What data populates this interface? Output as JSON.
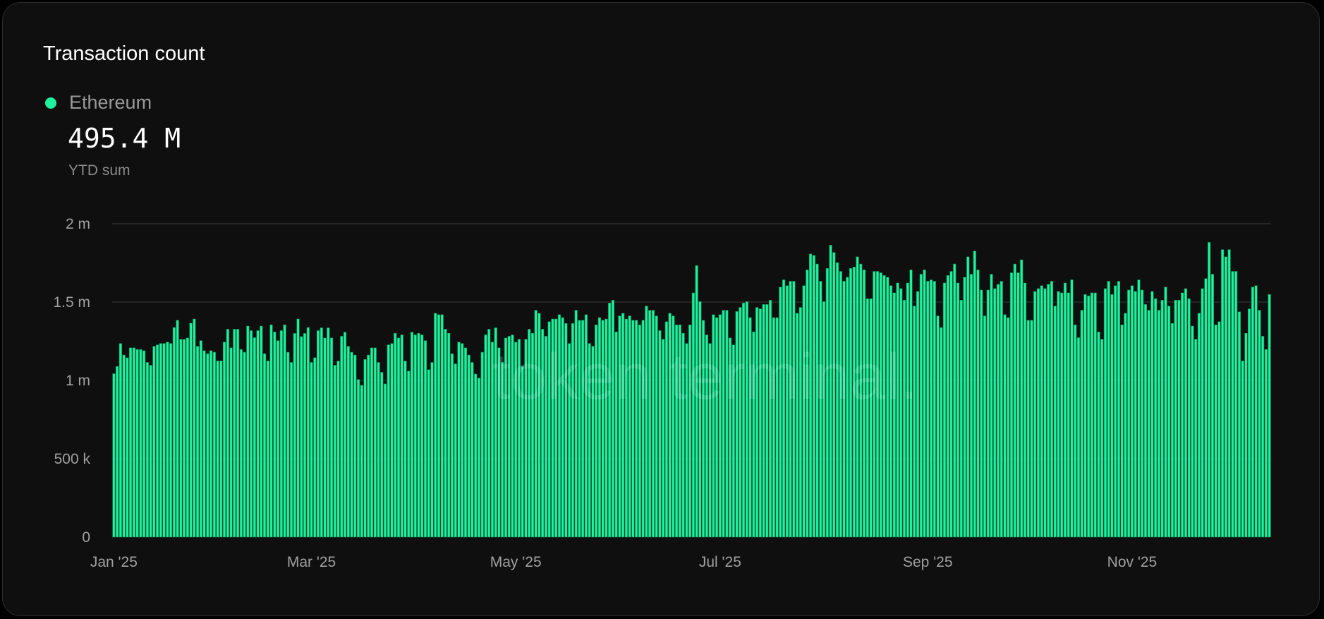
{
  "card": {
    "title": "Transaction count"
  },
  "legend": {
    "label": "Ethereum",
    "color": "#1ef29c"
  },
  "summary": {
    "value": "495.4 M",
    "caption": "YTD sum"
  },
  "watermark": "token terminal.",
  "chart_data": {
    "type": "bar",
    "title": "Transaction count",
    "series_name": "Ethereum",
    "x_start": "2025-01-01",
    "x_interval": "daily",
    "ylabel": "",
    "xlabel": "",
    "ylim": [
      0,
      2000000
    ],
    "grid": true,
    "y_ticks": [
      {
        "v": 0,
        "label": "0"
      },
      {
        "v": 500000,
        "label": "500 k"
      },
      {
        "v": 1000000,
        "label": "1 m"
      },
      {
        "v": 1500000,
        "label": "1.5 m"
      },
      {
        "v": 2000000,
        "label": "2 m"
      }
    ],
    "x_ticks": [
      {
        "i": 0,
        "label": "Jan '25"
      },
      {
        "i": 59,
        "label": "Mar '25"
      },
      {
        "i": 120,
        "label": "May '25"
      },
      {
        "i": 181,
        "label": "Jul '25"
      },
      {
        "i": 243,
        "label": "Sep '25"
      },
      {
        "i": 304,
        "label": "Nov '25"
      }
    ],
    "values_millions": [
      1.043,
      1.09,
      1.236,
      1.162,
      1.145,
      1.208,
      1.208,
      1.198,
      1.198,
      1.19,
      1.115,
      1.097,
      1.218,
      1.227,
      1.236,
      1.236,
      1.245,
      1.236,
      1.338,
      1.384,
      1.263,
      1.263,
      1.271,
      1.366,
      1.392,
      1.218,
      1.254,
      1.19,
      1.171,
      1.19,
      1.18,
      1.125,
      1.125,
      1.245,
      1.327,
      1.208,
      1.327,
      1.327,
      1.198,
      1.18,
      1.347,
      1.318,
      1.273,
      1.318,
      1.347,
      1.171,
      1.125,
      1.355,
      1.31,
      1.254,
      1.318,
      1.355,
      1.18,
      1.115,
      1.3,
      1.392,
      1.28,
      1.3,
      1.338,
      1.115,
      1.145,
      1.318,
      1.336,
      1.271,
      1.336,
      1.271,
      1.097,
      1.124,
      1.282,
      1.308,
      1.218,
      1.18,
      1.162,
      1.006,
      0.969,
      1.134,
      1.162,
      1.208,
      1.208,
      1.115,
      1.052,
      0.978,
      1.227,
      1.236,
      1.301,
      1.271,
      1.291,
      1.124,
      1.06,
      1.308,
      1.291,
      1.301,
      1.291,
      1.254,
      1.069,
      1.115,
      1.429,
      1.42,
      1.42,
      1.327,
      1.301,
      1.171,
      1.106,
      1.245,
      1.236,
      1.208,
      1.162,
      1.115,
      1.041,
      1.015,
      1.18,
      1.291,
      1.327,
      1.245,
      1.336,
      1.208,
      1.115,
      1.271,
      1.282,
      1.291,
      1.245,
      1.263,
      1.09,
      1.263,
      1.327,
      1.301,
      1.448,
      1.429,
      1.327,
      1.282,
      1.375,
      1.392,
      1.392,
      1.42,
      1.401,
      1.364,
      1.236,
      1.364,
      1.448,
      1.384,
      1.384,
      1.42,
      1.236,
      1.218,
      1.355,
      1.401,
      1.384,
      1.392,
      1.494,
      1.512,
      1.31,
      1.412,
      1.429,
      1.392,
      1.412,
      1.384,
      1.384,
      1.355,
      1.384,
      1.475,
      1.448,
      1.448,
      1.412,
      1.318,
      1.263,
      1.375,
      1.429,
      1.412,
      1.355,
      1.355,
      1.301,
      1.236,
      1.355,
      1.559,
      1.733,
      1.503,
      1.384,
      1.291,
      1.236,
      1.42,
      1.401,
      1.42,
      1.448,
      1.448,
      1.271,
      1.227,
      1.44,
      1.466,
      1.494,
      1.503,
      1.401,
      1.31,
      1.466,
      1.457,
      1.485,
      1.485,
      1.512,
      1.401,
      1.401,
      1.596,
      1.642,
      1.605,
      1.633,
      1.633,
      1.429,
      1.466,
      1.605,
      1.706,
      1.807,
      1.798,
      1.743,
      1.633,
      1.503,
      1.715,
      1.863,
      1.817,
      1.752,
      1.696,
      1.633,
      1.659,
      1.715,
      1.724,
      1.789,
      1.743,
      1.706,
      1.522,
      1.522,
      1.696,
      1.696,
      1.687,
      1.67,
      1.659,
      1.605,
      1.559,
      1.622,
      1.586,
      1.512,
      1.622,
      1.706,
      1.475,
      1.568,
      1.678,
      1.706,
      1.633,
      1.642,
      1.633,
      1.412,
      1.338,
      1.622,
      1.67,
      1.696,
      1.743,
      1.622,
      1.512,
      1.659,
      1.789,
      1.678,
      1.826,
      1.706,
      1.577,
      1.412,
      1.577,
      1.678,
      1.586,
      1.614,
      1.633,
      1.42,
      1.401,
      1.687,
      1.743,
      1.687,
      1.77,
      1.622,
      1.384,
      1.384,
      1.568,
      1.586,
      1.605,
      1.586,
      1.614,
      1.633,
      1.475,
      1.568,
      1.559,
      1.622,
      1.559,
      1.642,
      1.355,
      1.273,
      1.448,
      1.549,
      1.54,
      1.559,
      1.559,
      1.31,
      1.263,
      1.586,
      1.633,
      1.549,
      1.605,
      1.633,
      1.355,
      1.429,
      1.577,
      1.605,
      1.568,
      1.642,
      1.577,
      1.485,
      1.448,
      1.568,
      1.522,
      1.448,
      1.512,
      1.596,
      1.475,
      1.364,
      1.512,
      1.512,
      1.559,
      1.586,
      1.522,
      1.347,
      1.263,
      1.429,
      1.586,
      1.65,
      1.881,
      1.678,
      1.355,
      1.375,
      1.835,
      1.789,
      1.835,
      1.696,
      1.696,
      1.438,
      1.125,
      1.301,
      1.457,
      1.596,
      1.605,
      1.448,
      1.282,
      1.198,
      1.549
    ]
  }
}
